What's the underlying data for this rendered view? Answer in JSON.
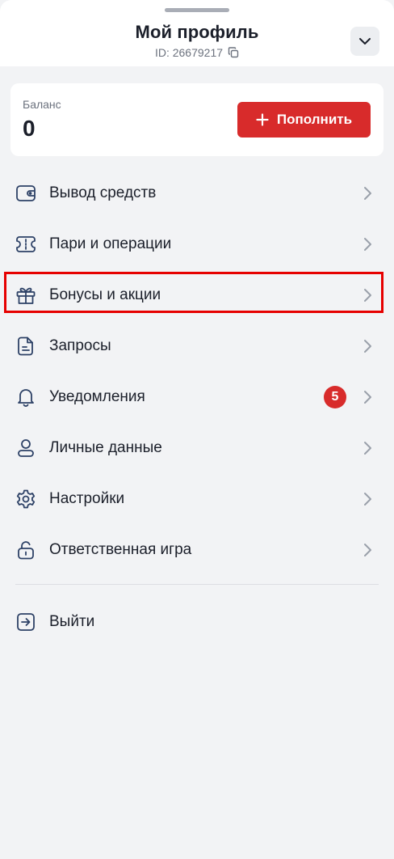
{
  "header": {
    "title": "Мой профиль",
    "id_text": "ID: 26679217"
  },
  "balance": {
    "label": "Баланс",
    "value": "0",
    "topup_label": "Пополнить"
  },
  "menu": {
    "items": [
      {
        "label": "Вывод средств",
        "icon": "wallet-icon"
      },
      {
        "label": "Пари и операции",
        "icon": "ticket-icon"
      },
      {
        "label": "Бонусы и акции",
        "icon": "gift-icon"
      },
      {
        "label": "Запросы",
        "icon": "document-icon"
      },
      {
        "label": "Уведомления",
        "icon": "bell-icon",
        "badge": "5"
      },
      {
        "label": "Личные данные",
        "icon": "user-icon"
      },
      {
        "label": "Настройки",
        "icon": "gear-icon"
      },
      {
        "label": "Ответственная игра",
        "icon": "unlock-icon"
      }
    ],
    "logout_label": "Выйти"
  },
  "colors": {
    "accent_red": "#d82b2b",
    "icon_blue": "#2d4166",
    "highlight": "#e60000"
  }
}
